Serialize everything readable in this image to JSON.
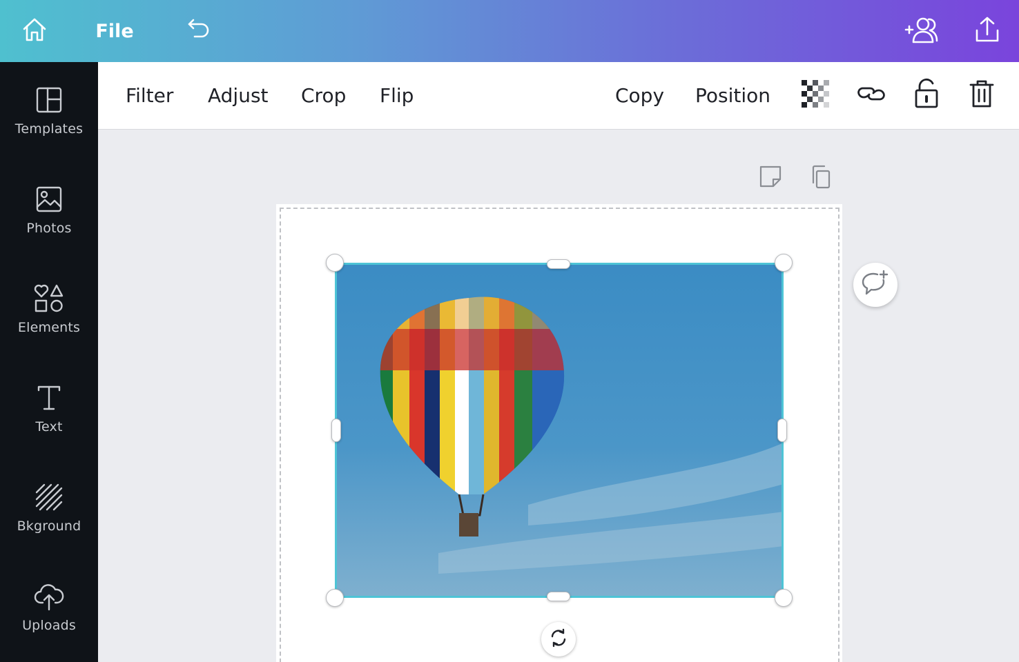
{
  "topbar": {
    "home_icon": "home-icon",
    "file_label": "File",
    "undo_icon": "undo-icon",
    "share_icon": "add-people-icon",
    "export_icon": "upload-share-icon",
    "gradient_colors": [
      "#4fc0cf",
      "#5f9bd5",
      "#6b6fd8",
      "#7a44dc"
    ]
  },
  "sidebar": {
    "items": [
      {
        "label": "Templates",
        "icon": "templates-icon"
      },
      {
        "label": "Photos",
        "icon": "photos-icon"
      },
      {
        "label": "Elements",
        "icon": "elements-icon"
      },
      {
        "label": "Text",
        "icon": "text-icon"
      },
      {
        "label": "Bkground",
        "icon": "background-icon"
      },
      {
        "label": "Uploads",
        "icon": "uploads-icon"
      }
    ],
    "background_color": "#0f1318"
  },
  "toolbar": {
    "left_items": [
      "Filter",
      "Adjust",
      "Crop",
      "Flip"
    ],
    "copy_label": "Copy",
    "position_label": "Position",
    "icons": [
      "transparency-icon",
      "link-icon",
      "unlock-icon",
      "trash-icon"
    ]
  },
  "canvas": {
    "page_icons": [
      "add-note-icon",
      "duplicate-page-icon"
    ],
    "image_subject": "hot-air-balloon",
    "selection_color": "#4ec4d6",
    "rotate_icon": "rotate-icon",
    "comment_icon": "add-comment-icon"
  }
}
